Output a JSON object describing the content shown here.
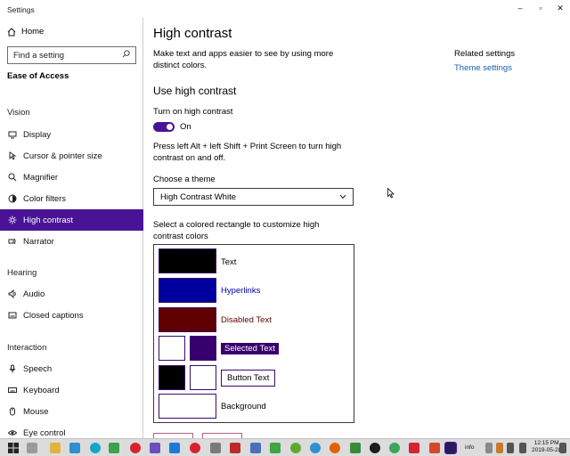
{
  "window": {
    "title": "Settings",
    "min_glyph": "–",
    "max_glyph": "▫",
    "close_glyph": "✕"
  },
  "sidebar": {
    "home_label": "Home",
    "search_placeholder": "Find a setting",
    "section_title": "Ease of Access",
    "groups": [
      {
        "title": "Vision",
        "items": [
          {
            "label": "Display",
            "icon": "display-icon"
          },
          {
            "label": "Cursor & pointer size",
            "icon": "cursor-icon"
          },
          {
            "label": "Magnifier",
            "icon": "magnifier-icon"
          },
          {
            "label": "Color filters",
            "icon": "color-filter-icon"
          },
          {
            "label": "High contrast",
            "icon": "brightness-icon",
            "active": true
          },
          {
            "label": "Narrator",
            "icon": "narrator-icon"
          }
        ]
      },
      {
        "title": "Hearing",
        "items": [
          {
            "label": "Audio",
            "icon": "speaker-icon"
          },
          {
            "label": "Closed captions",
            "icon": "captions-icon"
          }
        ]
      },
      {
        "title": "Interaction",
        "items": [
          {
            "label": "Speech",
            "icon": "microphone-icon"
          },
          {
            "label": "Keyboard",
            "icon": "keyboard-icon"
          },
          {
            "label": "Mouse",
            "icon": "mouse-icon"
          },
          {
            "label": "Eye control",
            "icon": "eye-icon"
          }
        ]
      }
    ]
  },
  "main": {
    "title": "High contrast",
    "description": "Make text and apps easier to see by using more distinct colors.",
    "related_title": "Related settings",
    "related_link": "Theme settings",
    "use_hc_title": "Use high contrast",
    "toggle_label": "Turn on high contrast",
    "toggle_state": "On",
    "toggle_on": true,
    "shortcut_text": "Press left Alt + left Shift + Print Screen to turn high contrast on and off.",
    "theme_label": "Choose a theme",
    "theme_value": "High Contrast White",
    "colors_text": "Select a colored rectangle to customize high contrast colors",
    "color_items": [
      {
        "label": "Text",
        "color": "#000000"
      },
      {
        "label": "Hyperlinks",
        "color": "#00009f"
      },
      {
        "label": "Disabled Text",
        "color": "#600000"
      },
      {
        "label": "Selected Text",
        "bg_color": "#ffffff",
        "fg_color": "#37006e"
      },
      {
        "label": "Button Text",
        "bg_color": "#000000",
        "fg_color": "#ffffff"
      },
      {
        "label": "Background",
        "color": "#ffffff"
      }
    ]
  },
  "colors": {
    "accent": "#4a1396",
    "link": "#1a5fb4"
  },
  "taskbar": {
    "info_label": "info",
    "time": "12:15 PM",
    "date": "2019-05-28"
  }
}
